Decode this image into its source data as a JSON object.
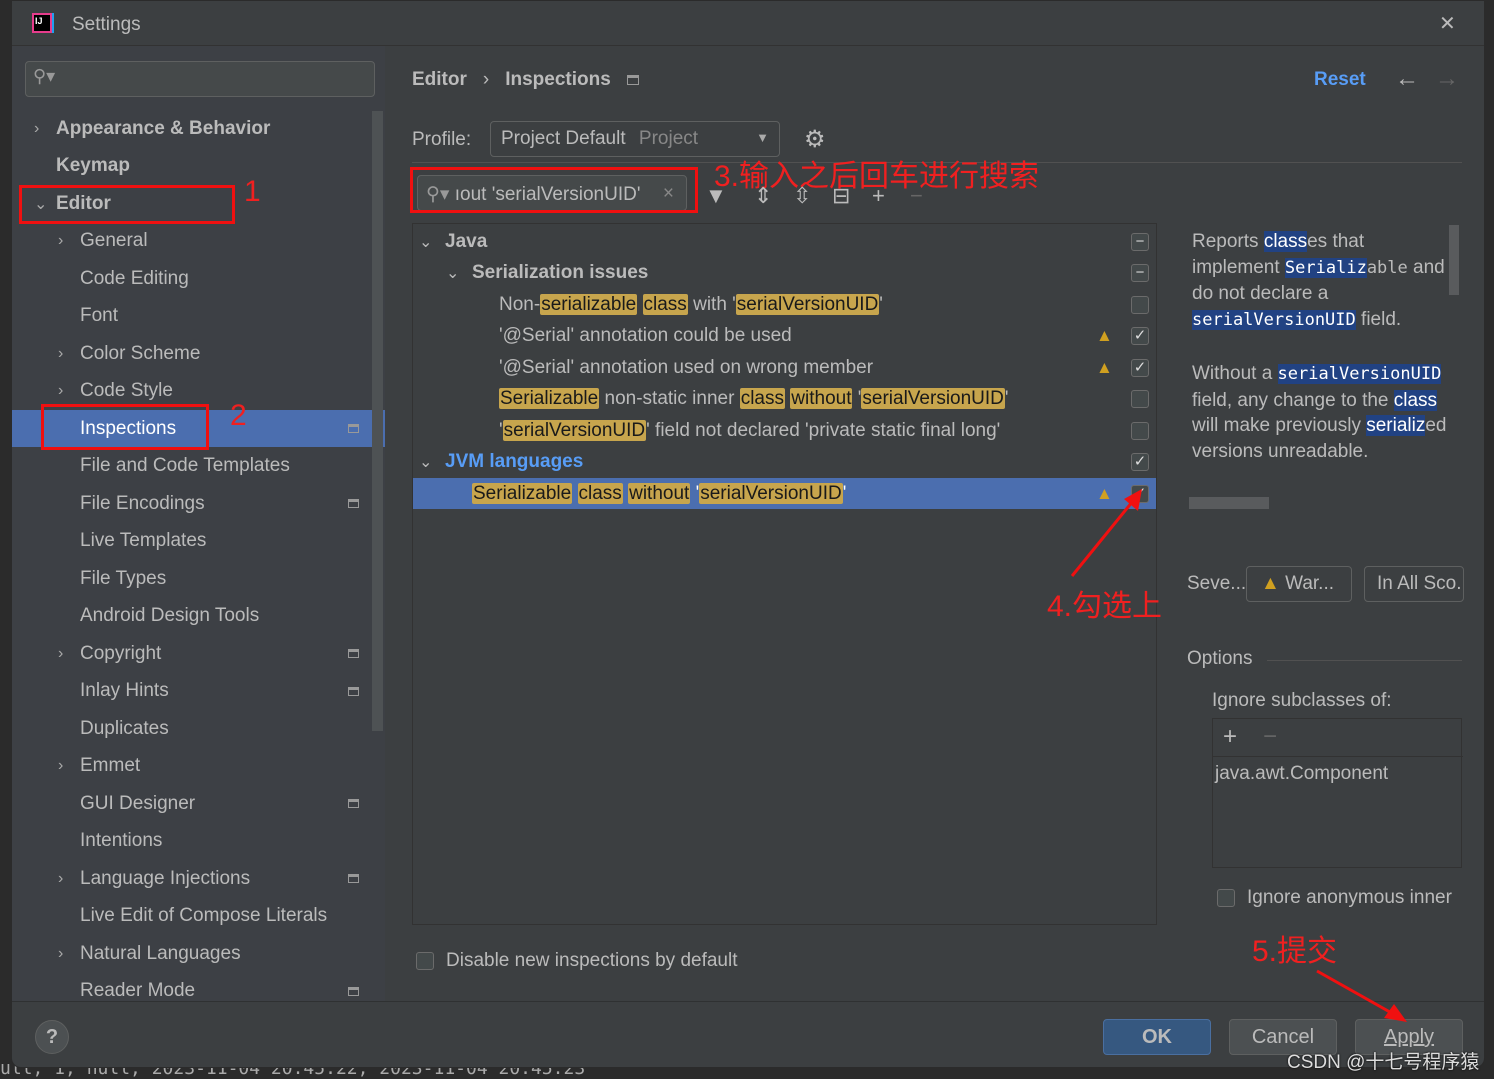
{
  "window": {
    "title": "Settings",
    "close": "✕"
  },
  "sidebar": {
    "items": [
      {
        "label": "Appearance & Behavior",
        "bold": true,
        "chev": "›",
        "indent": 0
      },
      {
        "label": "Keymap",
        "bold": true,
        "chev": "",
        "indent": 0
      },
      {
        "label": "Editor",
        "bold": true,
        "chev": "⌄",
        "indent": 0
      },
      {
        "label": "General",
        "chev": "›",
        "indent": 1
      },
      {
        "label": "Code Editing",
        "chev": "",
        "indent": 1
      },
      {
        "label": "Font",
        "chev": "",
        "indent": 1
      },
      {
        "label": "Color Scheme",
        "chev": "›",
        "indent": 1
      },
      {
        "label": "Code Style",
        "chev": "›",
        "indent": 1
      },
      {
        "label": "Inspections",
        "chev": "",
        "indent": 1,
        "selected": true,
        "page": true
      },
      {
        "label": "File and Code Templates",
        "chev": "",
        "indent": 1
      },
      {
        "label": "File Encodings",
        "chev": "",
        "indent": 1,
        "page": true
      },
      {
        "label": "Live Templates",
        "chev": "",
        "indent": 1
      },
      {
        "label": "File Types",
        "chev": "",
        "indent": 1
      },
      {
        "label": "Android Design Tools",
        "chev": "",
        "indent": 1
      },
      {
        "label": "Copyright",
        "chev": "›",
        "indent": 1,
        "page": true
      },
      {
        "label": "Inlay Hints",
        "chev": "",
        "indent": 1,
        "page": true
      },
      {
        "label": "Duplicates",
        "chev": "",
        "indent": 1
      },
      {
        "label": "Emmet",
        "chev": "›",
        "indent": 1
      },
      {
        "label": "GUI Designer",
        "chev": "",
        "indent": 1,
        "page": true
      },
      {
        "label": "Intentions",
        "chev": "",
        "indent": 1
      },
      {
        "label": "Language Injections",
        "chev": "›",
        "indent": 1,
        "page": true
      },
      {
        "label": "Live Edit of Compose Literals",
        "chev": "",
        "indent": 1
      },
      {
        "label": "Natural Languages",
        "chev": "›",
        "indent": 1
      },
      {
        "label": "Reader Mode",
        "chev": "",
        "indent": 1,
        "page": true
      }
    ]
  },
  "breadcrumb": {
    "parent": "Editor",
    "sep": "›",
    "current": "Inspections"
  },
  "header": {
    "reset": "Reset",
    "back": "←",
    "forward": "→"
  },
  "profile": {
    "label": "Profile:",
    "value": "Project Default",
    "scope": "Project"
  },
  "filter": {
    "value": "ıout 'serialVersionUID'"
  },
  "tree": [
    {
      "indent": 0,
      "chev": "⌄",
      "segs": [
        [
          "Java",
          0
        ]
      ],
      "bold": true,
      "check": "−"
    },
    {
      "indent": 1,
      "chev": "⌄",
      "segs": [
        [
          "Serialization issues",
          0
        ]
      ],
      "bold": true,
      "check": "−"
    },
    {
      "indent": 2,
      "segs": [
        [
          "Non-",
          0
        ],
        [
          "serializable",
          1
        ],
        [
          " ",
          0
        ],
        [
          "class",
          1
        ],
        [
          " with '",
          0
        ],
        [
          "serialVersionUID",
          1
        ],
        [
          "'",
          0
        ]
      ],
      "check": ""
    },
    {
      "indent": 2,
      "segs": [
        [
          "'@Serial' annotation could be used",
          0
        ]
      ],
      "warn": true,
      "check": "✓"
    },
    {
      "indent": 2,
      "segs": [
        [
          "'@Serial' annotation used on wrong member",
          0
        ]
      ],
      "warn": true,
      "check": "✓"
    },
    {
      "indent": 2,
      "segs": [
        [
          "Serializable",
          1
        ],
        [
          " non-static inner ",
          0
        ],
        [
          "class",
          1
        ],
        [
          " ",
          0
        ],
        [
          "without",
          1
        ],
        [
          " '",
          0
        ],
        [
          "serialVersionUID",
          1
        ],
        [
          "'",
          0
        ]
      ],
      "check": ""
    },
    {
      "indent": 2,
      "segs": [
        [
          "'",
          0
        ],
        [
          "serialVersionUID",
          1
        ],
        [
          "' field not declared 'private static final long'",
          0
        ]
      ],
      "check": ""
    },
    {
      "indent": 0,
      "chev": "⌄",
      "segs": [
        [
          "JVM languages",
          0
        ]
      ],
      "bold": true,
      "blue": true,
      "check": "✓"
    },
    {
      "indent": 1,
      "segs": [
        [
          "Serializable",
          1
        ],
        [
          " ",
          0
        ],
        [
          "class",
          1
        ],
        [
          " ",
          0
        ],
        [
          "without",
          1
        ],
        [
          " '",
          0
        ],
        [
          "serialVersionUID",
          1
        ],
        [
          "'",
          0
        ]
      ],
      "check": "✓",
      "warn": true,
      "selected": true
    }
  ],
  "description": {
    "p1": [
      [
        "Reports ",
        0
      ],
      [
        "class",
        2
      ],
      [
        "es that implement ",
        0
      ],
      [
        "Serializ",
        3
      ],
      [
        "able",
        4
      ],
      [
        " and do not declare a ",
        0
      ],
      [
        "serialVersionUID",
        3
      ],
      [
        " field.",
        0
      ]
    ],
    "p2": [
      [
        "Without a ",
        0
      ],
      [
        "serialVersionUID",
        3
      ],
      [
        " field, any change to the ",
        0
      ],
      [
        "class",
        2
      ],
      [
        " will make previously ",
        0
      ],
      [
        "serializ",
        2
      ],
      [
        "ed versions unreadable.",
        0
      ]
    ]
  },
  "severity": {
    "label": "Seve...",
    "value": "War...",
    "scope": "In All Sco..."
  },
  "options": {
    "title": "Options",
    "ignore_subclasses": "Ignore subclasses of:",
    "list": [
      "java.awt.Component"
    ],
    "ignore_anonymous": "Ignore anonymous inner"
  },
  "disable_new": "Disable new inspections by default",
  "buttons": {
    "ok": "OK",
    "cancel": "Cancel",
    "apply": "Apply",
    "help": "?"
  },
  "annotations": {
    "a1": "1",
    "a2": "2",
    "a3": "3.输入之后回车进行搜索",
    "a4": "4.勾选上",
    "a5": "5.提交"
  },
  "watermark": "CSDN @十七号程序猿",
  "background_text": "ull, 1, null, 2023-11-04 20:45:22, 2023-11-04 20:45:23",
  "colors": {
    "selection": "#4b6eaf",
    "highlight": "#c7a54d",
    "annotation": "#f01010",
    "link": "#589df6"
  }
}
